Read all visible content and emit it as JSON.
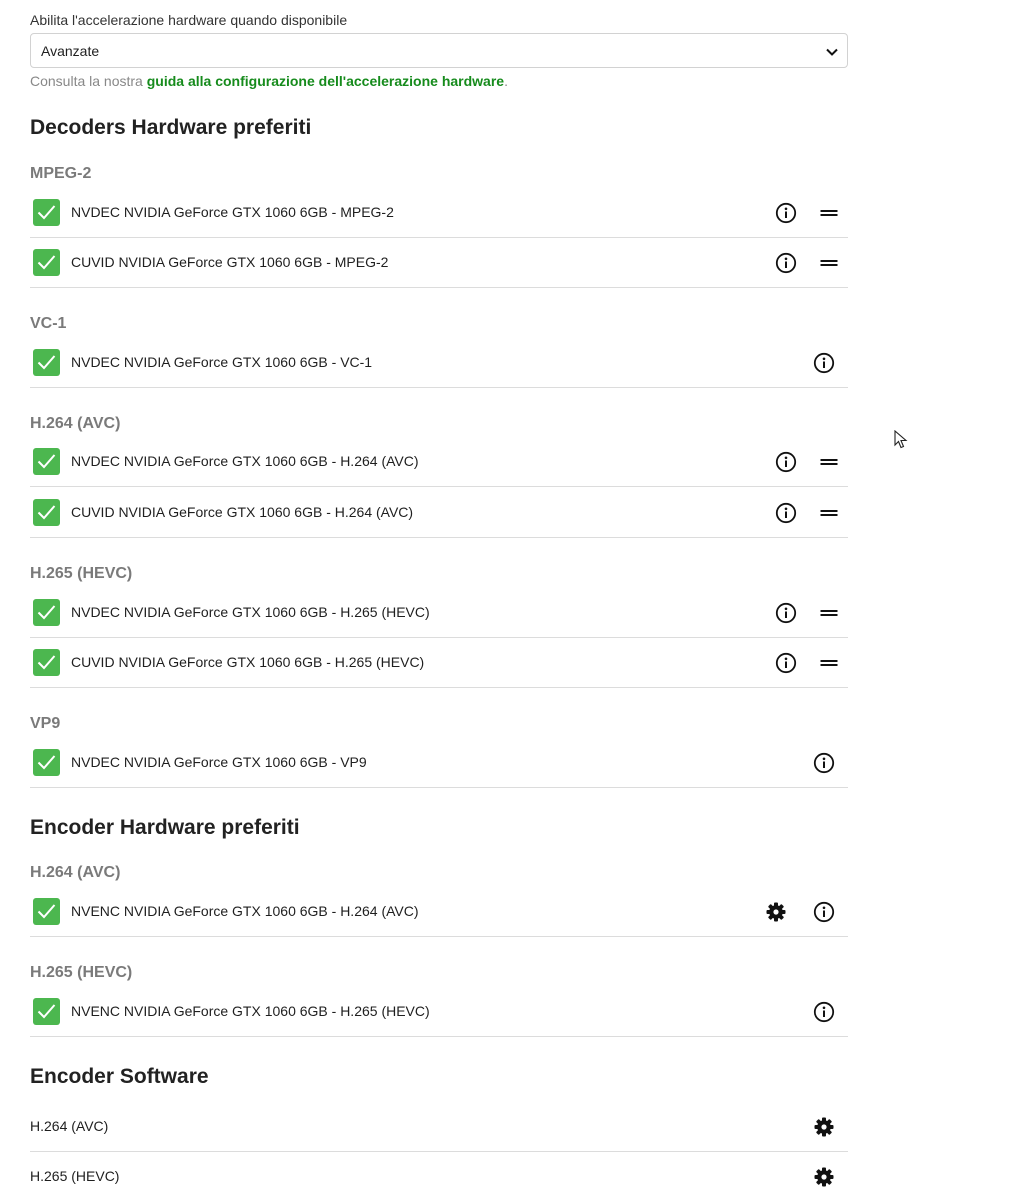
{
  "hw_accel": {
    "label": "Abilita l'accelerazione hardware quando disponibile",
    "selected": "Avanzate",
    "help_prefix": "Consulta la nostra ",
    "help_link": "guida alla configurazione dell'accelerazione hardware",
    "help_suffix": "."
  },
  "decoders": {
    "title": "Decoders Hardware preferiti",
    "groups": [
      {
        "name": "MPEG-2",
        "items": [
          {
            "label": "NVDEC NVIDIA GeForce GTX 1060 6GB - MPEG-2",
            "checked": true,
            "icons": [
              "info-icon",
              "drag-handle-icon"
            ]
          },
          {
            "label": "CUVID NVIDIA GeForce GTX 1060 6GB - MPEG-2",
            "checked": true,
            "icons": [
              "info-icon",
              "drag-handle-icon"
            ]
          }
        ]
      },
      {
        "name": "VC-1",
        "items": [
          {
            "label": "NVDEC NVIDIA GeForce GTX 1060 6GB - VC-1",
            "checked": true,
            "icons": [
              "info-icon"
            ]
          }
        ]
      },
      {
        "name": "H.264 (AVC)",
        "items": [
          {
            "label": "NVDEC NVIDIA GeForce GTX 1060 6GB - H.264 (AVC)",
            "checked": true,
            "icons": [
              "info-icon",
              "drag-handle-icon"
            ]
          },
          {
            "label": "CUVID NVIDIA GeForce GTX 1060 6GB - H.264 (AVC)",
            "checked": true,
            "icons": [
              "info-icon",
              "drag-handle-icon"
            ]
          }
        ]
      },
      {
        "name": "H.265 (HEVC)",
        "items": [
          {
            "label": "NVDEC NVIDIA GeForce GTX 1060 6GB - H.265 (HEVC)",
            "checked": true,
            "icons": [
              "info-icon",
              "drag-handle-icon"
            ]
          },
          {
            "label": "CUVID NVIDIA GeForce GTX 1060 6GB - H.265 (HEVC)",
            "checked": true,
            "icons": [
              "info-icon",
              "drag-handle-icon"
            ]
          }
        ]
      },
      {
        "name": "VP9",
        "items": [
          {
            "label": "NVDEC NVIDIA GeForce GTX 1060 6GB - VP9",
            "checked": true,
            "icons": [
              "info-icon"
            ]
          }
        ]
      }
    ]
  },
  "encoders": {
    "title": "Encoder Hardware preferiti",
    "groups": [
      {
        "name": "H.264 (AVC)",
        "items": [
          {
            "label": "NVENC NVIDIA GeForce GTX 1060 6GB - H.264 (AVC)",
            "checked": true,
            "icons": [
              "gear-icon",
              "info-icon"
            ]
          }
        ]
      },
      {
        "name": "H.265 (HEVC)",
        "items": [
          {
            "label": "NVENC NVIDIA GeForce GTX 1060 6GB - H.265 (HEVC)",
            "checked": true,
            "icons": [
              "info-icon"
            ]
          }
        ]
      }
    ]
  },
  "software_encoders": {
    "title": "Encoder Software",
    "items": [
      {
        "label": "H.264 (AVC)",
        "icons": [
          "gear-icon"
        ]
      },
      {
        "label": "H.265 (HEVC)",
        "icons": [
          "gear-icon"
        ]
      }
    ]
  },
  "colors": {
    "accent": "#168b1c",
    "checkbox": "#4cb74f"
  }
}
